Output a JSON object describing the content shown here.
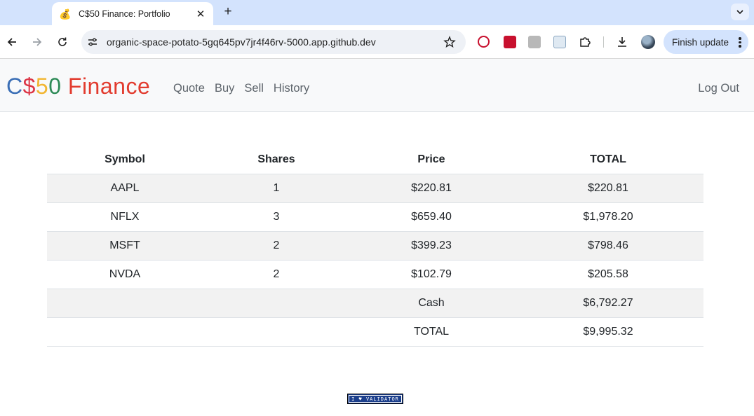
{
  "browser": {
    "tab_title": "C$50 Finance: Portfolio",
    "tab_favicon": "💰",
    "url": "organic-space-potato-5gq645pv7jr4f46rv-5000.app.github.dev",
    "update_button": "Finish update"
  },
  "brand": {
    "parts": [
      {
        "text": "C",
        "color": "#3b6fb6"
      },
      {
        "text": "$",
        "color": "#dc3545"
      },
      {
        "text": "5",
        "color": "#f2b632"
      },
      {
        "text": "0",
        "color": "#2e8b57"
      },
      {
        "text": " Finance",
        "color": "#e23b2e"
      }
    ]
  },
  "nav": {
    "links": [
      "Quote",
      "Buy",
      "Sell",
      "History"
    ],
    "logout": "Log Out"
  },
  "table": {
    "headers": [
      "Symbol",
      "Shares",
      "Price",
      "TOTAL"
    ],
    "rows": [
      [
        "AAPL",
        "1",
        "$220.81",
        "$220.81"
      ],
      [
        "NFLX",
        "3",
        "$659.40",
        "$1,978.20"
      ],
      [
        "MSFT",
        "2",
        "$399.23",
        "$798.46"
      ],
      [
        "NVDA",
        "2",
        "$102.79",
        "$205.58"
      ],
      [
        "",
        "",
        "Cash",
        "$6,792.27"
      ],
      [
        "",
        "",
        "TOTAL",
        "$9,995.32"
      ]
    ]
  },
  "footer": {
    "validator_badge": "I ♥ VALIDATOR"
  }
}
